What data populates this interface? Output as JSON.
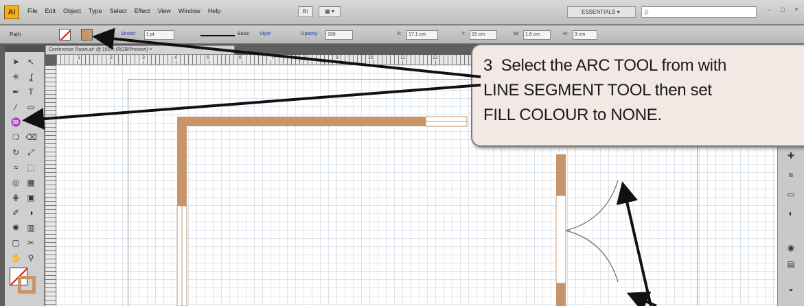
{
  "app": {
    "logo": "Ai"
  },
  "menu": [
    "File",
    "Edit",
    "Object",
    "Type",
    "Select",
    "Effect",
    "View",
    "Window",
    "Help"
  ],
  "menubar_icons": {
    "bridge": "Br",
    "arrange": "▦ ▾"
  },
  "workspace": {
    "label": "ESSENTIALS ▾"
  },
  "search": {
    "placeholder": "ρ",
    "value": ""
  },
  "window_controls": {
    "minimize": "–",
    "restore": "□",
    "close": "×"
  },
  "controlbar": {
    "selection_label": "Path",
    "stroke_label": "Stroke:",
    "stroke_weight": "1 pt",
    "profile_label": "Basic",
    "style_label": "Style:",
    "opacity_label": "Opacity:",
    "opacity_value": "100",
    "x_value": "17.1 cm",
    "y_value": "15 cm",
    "w_value": "1.6 cm",
    "h_value": "3 cm"
  },
  "document_tab": {
    "title": "Conference Room.ai* @ 150% (RGB/Preview) ×"
  },
  "ruler": {
    "top_numbers": [
      "1",
      "2",
      "3",
      "4",
      "5",
      "6",
      "7",
      "8",
      "9",
      "10",
      "11",
      "12"
    ]
  },
  "toolbox": {
    "tools": [
      "selection-tool",
      "direct-selection-tool",
      "magic-wand-tool",
      "lasso-tool",
      "pen-tool",
      "type-tool",
      "line-segment-tool",
      "rectangle-tool",
      "paintbrush-tool",
      "pencil-tool",
      "blob-brush-tool",
      "eraser-tool",
      "rotate-tool",
      "scale-tool",
      "width-tool",
      "free-transform-tool",
      "shape-builder-tool",
      "perspective-grid-tool",
      "mesh-tool",
      "gradient-tool",
      "eyedropper-tool",
      "blend-tool",
      "symbol-sprayer-tool",
      "column-graph-tool",
      "artboard-tool",
      "slice-tool",
      "hand-tool",
      "zoom-tool"
    ]
  },
  "colors": {
    "wall": "#c8956a",
    "fill_none_slash": "#e00000",
    "callout_bg": "#f2e8e4"
  },
  "callout": {
    "text": "3  Select the ARC TOOL from with\nLINE SEGMENT TOOL then set\nFILL COLOUR to NONE."
  },
  "dock_icons": [
    "color-panel-icon",
    "stroke-panel-icon",
    "gradient-panel-icon",
    "transparency-panel-icon",
    "appearance-panel-icon",
    "layers-panel-icon",
    "artboards-panel-icon"
  ]
}
